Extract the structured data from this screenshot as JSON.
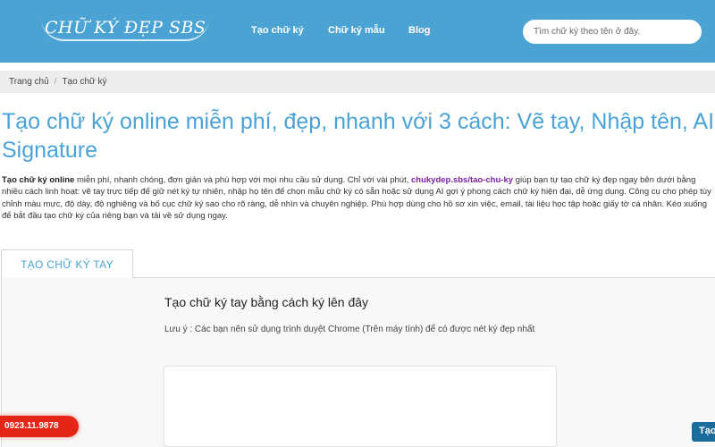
{
  "header": {
    "logo": "CHỮ KÝ ĐẸP SBS",
    "nav": [
      "Tạo chữ ký",
      "Chữ ký mẫu",
      "Blog"
    ],
    "search_placeholder": "Tìm chữ ký theo tên ở đây."
  },
  "breadcrumb": {
    "home": "Trang chủ",
    "separator": "/",
    "current": "Tạo chữ ký"
  },
  "main": {
    "title": "Tạo chữ ký online miễn phí, đẹp, nhanh với 3 cách: Vẽ tay, Nhập tên, AI Signature",
    "intro_bold": "Tạo chữ ký online",
    "intro_part1": " miễn phí, nhanh chóng, đơn giản và phù hợp với mọi nhu cầu sử dụng. Chỉ với vài phút, ",
    "intro_link": "chukydep.sbs/tao-chu-ky",
    "intro_part2": " giúp bạn tự tạo chữ ký đẹp ngay bên dưới bằng nhiều cách linh hoạt: vẽ tay trực tiếp để giữ nét ký tự nhiên, nhập họ tên để chọn mẫu chữ ký có sẵn hoặc sử dụng AI gợi ý phong cách chữ ký hiện đại, dễ ứng dụng. Công cụ cho phép tùy chỉnh màu mực, độ dày, độ nghiêng và bố cục chữ ký sao cho rõ ràng, dễ nhìn và chuyên nghiệp. Phù hợp dùng cho hồ sơ xin việc, email, tài liệu học tập hoặc giấy tờ cá nhân. Kéo xuống để bắt đầu tạo chữ ký của riêng bạn và tải về sử dụng ngay.",
    "tab_label": "TẠO CHỮ KÝ TAY",
    "section_heading": "Tạo chữ ký tay bằng cách ký lên đây",
    "note": "Lưu ý : Các bạn nên sử dụng trình duyệt Chrome (Trên máy tính) để có được nét ký đẹp nhất"
  },
  "floating": {
    "phone": "0923.11.9878",
    "cta": "Tạo"
  },
  "colors": {
    "header_bg": "#4ba3d3",
    "title": "#4aa3d6",
    "link": "#7b1fa2",
    "phone_bg": "#e42618",
    "cta_bg": "#1a6c9c"
  }
}
